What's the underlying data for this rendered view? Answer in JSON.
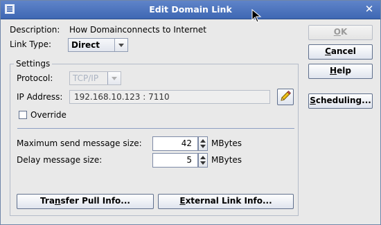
{
  "window": {
    "title": "Edit Domain Link",
    "close_glyph": "✕"
  },
  "description": {
    "label": "Description:",
    "value": "How Domainconnects to Internet"
  },
  "link_type": {
    "label": "Link Type:",
    "value": "Direct"
  },
  "settings": {
    "title": "Settings",
    "protocol": {
      "label": "Protocol:",
      "value": "TCP/IP"
    },
    "ip_address": {
      "label": "IP Address:",
      "value": "192.168.10.123 : 7110"
    },
    "override": {
      "label": "Override",
      "checked": false
    },
    "max_send": {
      "label": "Maximum send message size:",
      "value": "42",
      "unit": "MBytes"
    },
    "delay": {
      "label": "Delay message size:",
      "value": "5",
      "unit": "MBytes"
    }
  },
  "buttons": {
    "ok": {
      "pre": "",
      "mnemonic": "O",
      "post": "K"
    },
    "cancel": {
      "pre": "",
      "mnemonic": "C",
      "post": "ancel"
    },
    "help": {
      "pre": "",
      "mnemonic": "H",
      "post": "elp"
    },
    "scheduling": {
      "pre": "",
      "mnemonic": "S",
      "post": "cheduling..."
    },
    "transfer_pull": {
      "pre": "Tra",
      "mnemonic": "n",
      "post": "sfer Pull Info..."
    },
    "external_link": {
      "pre": "",
      "mnemonic": "E",
      "post": "xternal Link Info..."
    }
  },
  "icons": {
    "window_menu": "window-menu-icon",
    "edit": "pencil-icon",
    "cursor": "mouse-pointer-icon"
  },
  "colors": {
    "titlebar": "#4a72bd",
    "dialog_bg": "#e9e9e9",
    "separator": "#8da0c3"
  }
}
